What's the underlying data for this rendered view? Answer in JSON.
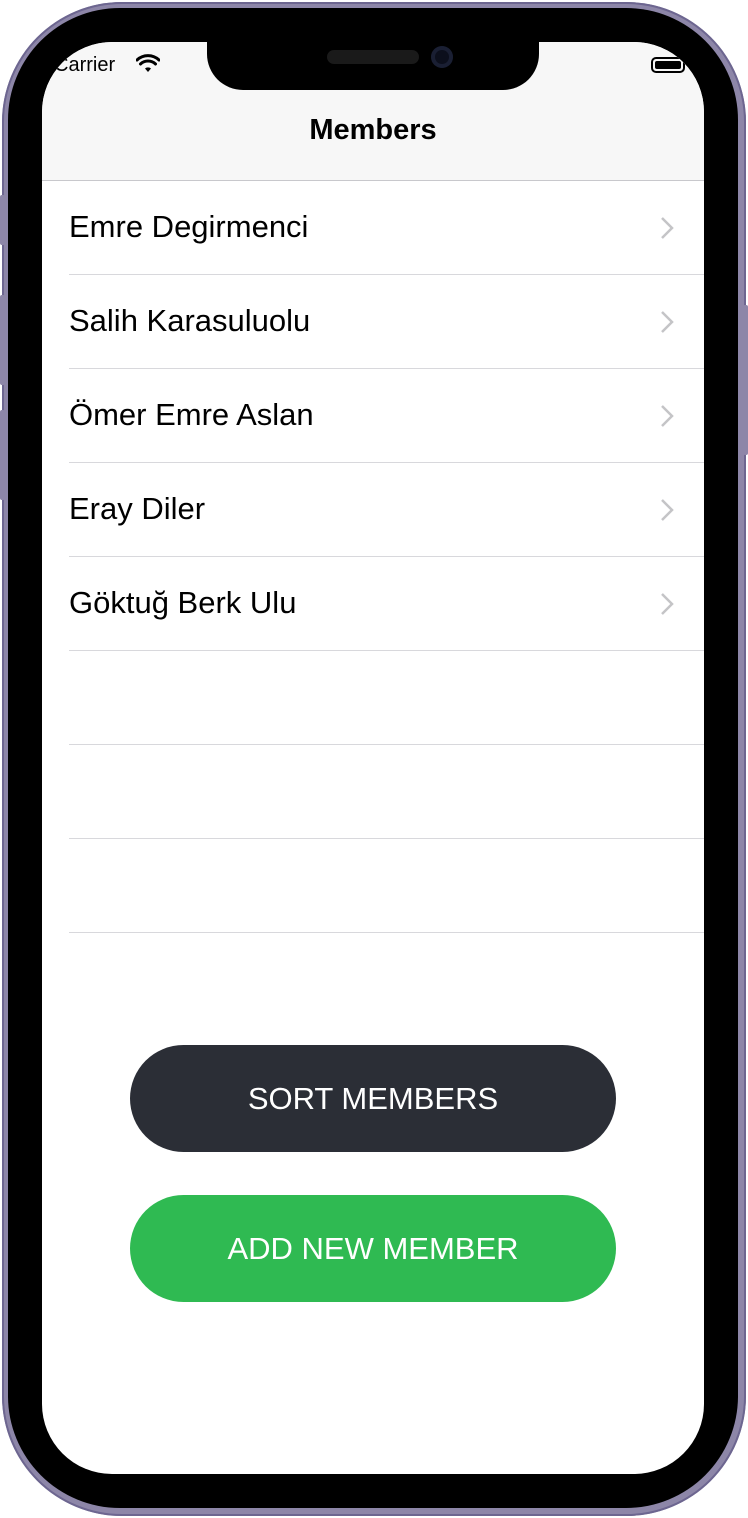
{
  "status_bar": {
    "carrier": "Carrier"
  },
  "nav": {
    "title": "Members"
  },
  "members": [
    {
      "name": "Emre Degirmenci"
    },
    {
      "name": "Salih Karasuluolu"
    },
    {
      "name": "Ömer Emre Aslan"
    },
    {
      "name": "Eray Diler"
    },
    {
      "name": "Göktuğ Berk Ulu"
    },
    {
      "name": ""
    },
    {
      "name": ""
    },
    {
      "name": ""
    }
  ],
  "buttons": {
    "sort_label": "SORT MEMBERS",
    "add_label": "ADD NEW MEMBER"
  },
  "colors": {
    "sort_button": "#2b2e36",
    "add_button": "#2fba52",
    "nav_background": "#f7f7f7",
    "frame": "#8d86a8"
  },
  "icons": {
    "wifi": "wifi-icon",
    "battery": "battery-icon",
    "chevron": "chevron-right-icon"
  }
}
